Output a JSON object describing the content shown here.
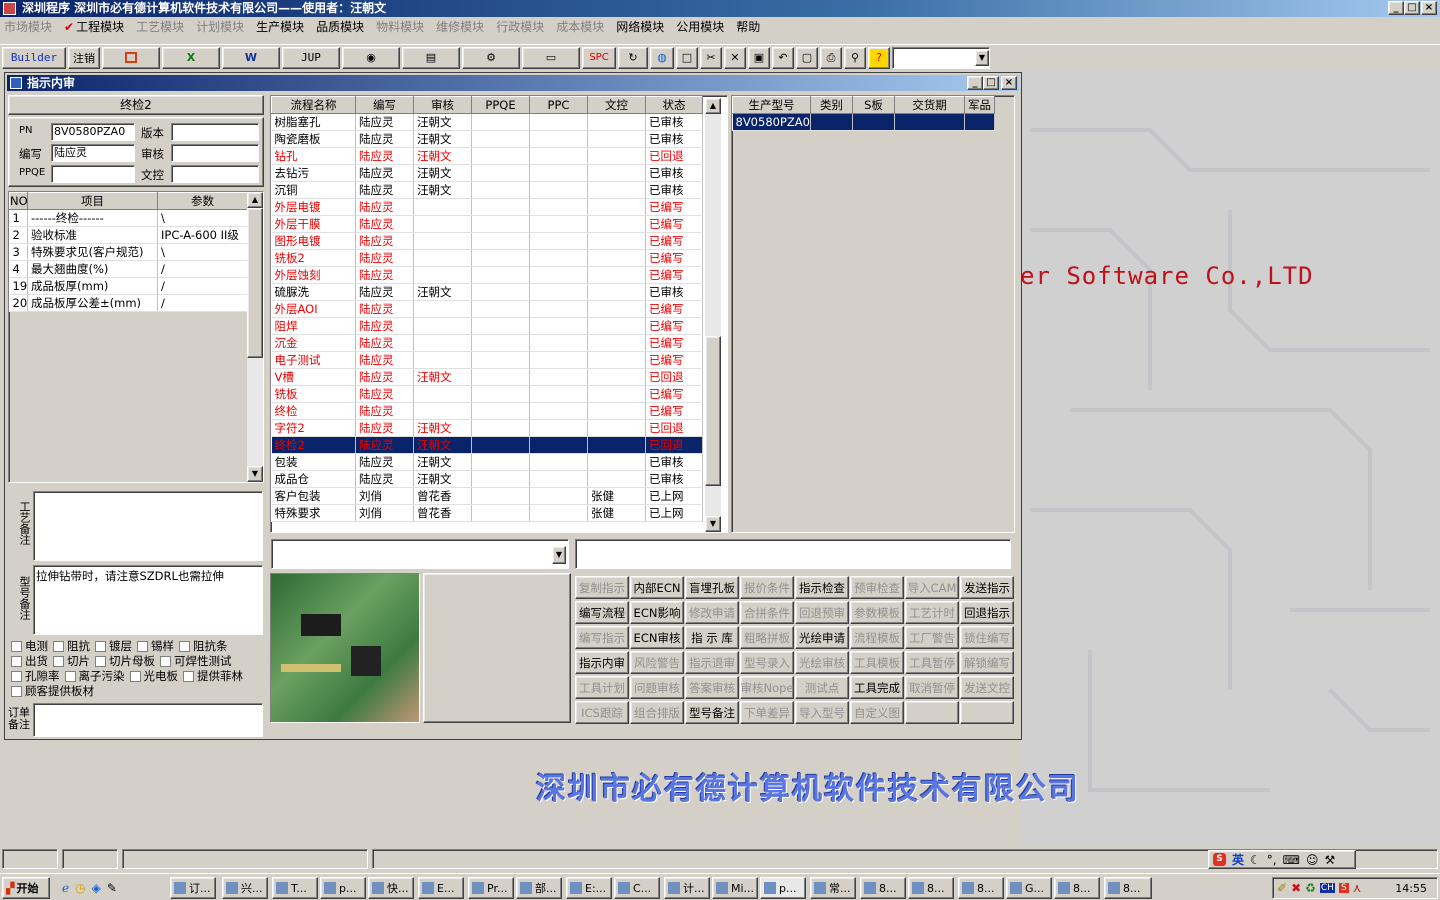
{
  "app": {
    "title": "深圳程序  深圳市必有德计算机软件技术有限公司——使用者：汪朝文"
  },
  "menu": [
    {
      "label": "市场模块",
      "enabled": false
    },
    {
      "label": "工程模块",
      "enabled": true
    },
    {
      "label": "工艺模块",
      "enabled": false
    },
    {
      "label": "计划模块",
      "enabled": false
    },
    {
      "label": "生产模块",
      "enabled": true
    },
    {
      "label": "品质模块",
      "enabled": true
    },
    {
      "label": "物料模块",
      "enabled": false
    },
    {
      "label": "维修模块",
      "enabled": false
    },
    {
      "label": "行政模块",
      "enabled": false
    },
    {
      "label": "成本模块",
      "enabled": false
    },
    {
      "label": "网络模块",
      "enabled": true
    },
    {
      "label": "公用模块",
      "enabled": true
    },
    {
      "label": "帮助",
      "enabled": true
    }
  ],
  "toolbar": {
    "builder": "Builder",
    "logout": "注销",
    "jup": "JUP",
    "spc": "SPC"
  },
  "watermark": {
    "en": "er Software Co.,LTD",
    "cn": "深圳市必有德计算机软件技术有限公司"
  },
  "child": {
    "title": "指示内审"
  },
  "left": {
    "section": "终检2",
    "pn_label": "PN",
    "pn": "8V0580PZA0",
    "version_label": "版本",
    "version": "",
    "author_label": "编写",
    "author": "陆应灵",
    "review_label": "审核",
    "review": "",
    "ppqe_label": "PPQE",
    "ppqe": "",
    "doc_label": "文控",
    "doc": ""
  },
  "params": {
    "headers": [
      "NO",
      "项目",
      "参数"
    ],
    "rows": [
      [
        "1",
        "------终检------",
        "\\"
      ],
      [
        "2",
        "验收标准",
        "IPC-A-600 II级"
      ],
      [
        "3",
        "特殊要求见(客户规范)",
        "\\"
      ],
      [
        "4",
        "最大翘曲度(%)",
        "/"
      ],
      [
        "19",
        "成品板厚(mm)",
        "/"
      ],
      [
        "20",
        "成品板厚公差±(mm)",
        "/"
      ]
    ]
  },
  "notes": {
    "process_label": "工艺备注",
    "process": "",
    "model_label": "型号备注",
    "model": "拉伸钻带时，请注意SZDRL也需拉伸",
    "order_label": "订单备注"
  },
  "checkboxes": [
    "电测",
    "阻抗",
    "镀层",
    "锡样",
    "阻抗条",
    "出货",
    "切片",
    "切片母板",
    "可焊性测试",
    "孔隙率",
    "离子污染",
    "光电板",
    "提供菲林",
    "顾客提供板材"
  ],
  "flow": {
    "headers": [
      "流程名称",
      "编写",
      "审核",
      "PPQE",
      "PPC",
      "文控",
      "状态"
    ],
    "rows": [
      {
        "c": [
          "树脂塞孔",
          "陆应灵",
          "汪朝文",
          "",
          "",
          "",
          "已审核"
        ],
        "s": "n"
      },
      {
        "c": [
          "陶瓷磨板",
          "陆应灵",
          "汪朝文",
          "",
          "",
          "",
          "已审核"
        ],
        "s": "n"
      },
      {
        "c": [
          "钻孔",
          "陆应灵",
          "汪朝文",
          "",
          "",
          "",
          "已回退"
        ],
        "s": "r"
      },
      {
        "c": [
          "去钻污",
          "陆应灵",
          "汪朝文",
          "",
          "",
          "",
          "已审核"
        ],
        "s": "n"
      },
      {
        "c": [
          "沉铜",
          "陆应灵",
          "汪朝文",
          "",
          "",
          "",
          "已审核"
        ],
        "s": "n"
      },
      {
        "c": [
          "外层电镀",
          "陆应灵",
          "",
          "",
          "",
          "",
          "已编写"
        ],
        "s": "r"
      },
      {
        "c": [
          "外层干膜",
          "陆应灵",
          "",
          "",
          "",
          "",
          "已编写"
        ],
        "s": "r"
      },
      {
        "c": [
          "图形电镀",
          "陆应灵",
          "",
          "",
          "",
          "",
          "已编写"
        ],
        "s": "r"
      },
      {
        "c": [
          "铣板2",
          "陆应灵",
          "",
          "",
          "",
          "",
          "已编写"
        ],
        "s": "r"
      },
      {
        "c": [
          "外层蚀刻",
          "陆应灵",
          "",
          "",
          "",
          "",
          "已编写"
        ],
        "s": "r"
      },
      {
        "c": [
          "硫脲洗",
          "陆应灵",
          "汪朝文",
          "",
          "",
          "",
          "已审核"
        ],
        "s": "n"
      },
      {
        "c": [
          "外层AOI",
          "陆应灵",
          "",
          "",
          "",
          "",
          "已编写"
        ],
        "s": "r"
      },
      {
        "c": [
          "阻焊",
          "陆应灵",
          "",
          "",
          "",
          "",
          "已编写"
        ],
        "s": "r"
      },
      {
        "c": [
          "沉金",
          "陆应灵",
          "",
          "",
          "",
          "",
          "已编写"
        ],
        "s": "r"
      },
      {
        "c": [
          "电子测试",
          "陆应灵",
          "",
          "",
          "",
          "",
          "已编写"
        ],
        "s": "r"
      },
      {
        "c": [
          "V槽",
          "陆应灵",
          "汪朝文",
          "",
          "",
          "",
          "已回退"
        ],
        "s": "r"
      },
      {
        "c": [
          "铣板",
          "陆应灵",
          "",
          "",
          "",
          "",
          "已编写"
        ],
        "s": "r"
      },
      {
        "c": [
          "终检",
          "陆应灵",
          "",
          "",
          "",
          "",
          "已编写"
        ],
        "s": "r"
      },
      {
        "c": [
          "字符2",
          "陆应灵",
          "汪朝文",
          "",
          "",
          "",
          "已回退"
        ],
        "s": "r"
      },
      {
        "c": [
          "终检2",
          "陆应灵",
          "汪朝文",
          "",
          "",
          "",
          "已回退"
        ],
        "s": "sel"
      },
      {
        "c": [
          "包装",
          "陆应灵",
          "汪朝文",
          "",
          "",
          "",
          "已审核"
        ],
        "s": "n"
      },
      {
        "c": [
          "成品仓",
          "陆应灵",
          "汪朝文",
          "",
          "",
          "",
          "已审核"
        ],
        "s": "n"
      },
      {
        "c": [
          "客户包装",
          "刘俏",
          "曾花香",
          "",
          "",
          "张健",
          "已上网"
        ],
        "s": "n"
      },
      {
        "c": [
          "特殊要求",
          "刘俏",
          "曾花香",
          "",
          "",
          "张健",
          "已上网"
        ],
        "s": "n"
      }
    ]
  },
  "models": {
    "headers": [
      "生产型号",
      "类别",
      "S板",
      "交货期",
      "军品"
    ],
    "rows": [
      [
        "8V0580PZA0",
        "",
        "",
        "",
        ""
      ]
    ]
  },
  "buttons": [
    [
      {
        "t": "复制指示",
        "e": false
      },
      {
        "t": "内部ECN",
        "e": true
      },
      {
        "t": "盲埋孔板",
        "e": true
      },
      {
        "t": "报价条件",
        "e": false
      },
      {
        "t": "指示检查",
        "e": true
      },
      {
        "t": "预审检查",
        "e": false
      },
      {
        "t": "导入CAM",
        "e": false
      },
      {
        "t": "发送指示",
        "e": true
      }
    ],
    [
      {
        "t": "编写流程",
        "e": true
      },
      {
        "t": "ECN影响",
        "e": true
      },
      {
        "t": "修改申请",
        "e": false
      },
      {
        "t": "合拼条件",
        "e": false
      },
      {
        "t": "回退预审",
        "e": false
      },
      {
        "t": "参数模板",
        "e": false
      },
      {
        "t": "工艺计时",
        "e": false
      },
      {
        "t": "回退指示",
        "e": true
      }
    ],
    [
      {
        "t": "编写指示",
        "e": false
      },
      {
        "t": "ECN审核",
        "e": true
      },
      {
        "t": "指 示 库",
        "e": true
      },
      {
        "t": "粗略拼板",
        "e": false
      },
      {
        "t": "光绘申请",
        "e": true
      },
      {
        "t": "流程模板",
        "e": false
      },
      {
        "t": "工厂警告",
        "e": false
      },
      {
        "t": "锁住编写",
        "e": false
      }
    ],
    [
      {
        "t": "指示内审",
        "e": true
      },
      {
        "t": "风险警告",
        "e": false
      },
      {
        "t": "指示退审",
        "e": false
      },
      {
        "t": "型号录入",
        "e": false
      },
      {
        "t": "光绘审核",
        "e": false
      },
      {
        "t": "工具模板",
        "e": false
      },
      {
        "t": "工具暂停",
        "e": false
      },
      {
        "t": "解锁编写",
        "e": false
      }
    ],
    [
      {
        "t": "工具计划",
        "e": false
      },
      {
        "t": "问题审核",
        "e": false
      },
      {
        "t": "答案审核",
        "e": false
      },
      {
        "t": "审核Nope",
        "e": false
      },
      {
        "t": "测试点",
        "e": false
      },
      {
        "t": "工具完成",
        "e": true
      },
      {
        "t": "取消暂停",
        "e": false
      },
      {
        "t": "发送文控",
        "e": false
      }
    ],
    [
      {
        "t": "ICS跟踪",
        "e": false
      },
      {
        "t": "组合排版",
        "e": false
      },
      {
        "t": "型号备注",
        "e": true
      },
      {
        "t": "下单差异",
        "e": false
      },
      {
        "t": "导入型号",
        "e": false
      },
      {
        "t": "自定义图",
        "e": false
      },
      {
        "t": "",
        "e": false
      },
      {
        "t": "",
        "e": false
      }
    ]
  ],
  "ime": {
    "lang": "英"
  },
  "taskbar": {
    "start": "开始",
    "tasks": [
      "订...",
      "兴...",
      "T...",
      "p...",
      "快...",
      "E...",
      "Pr...",
      "部...",
      "E:...",
      "C...",
      "计...",
      "Mi...",
      "p...",
      "常...",
      "8...",
      "8...",
      "8...",
      "G...",
      "8...",
      "8..."
    ],
    "clock": "14:55",
    "tray_lang": "CH"
  },
  "colors": {
    "title_start": "#0a246a",
    "title_end": "#a6caf0",
    "red_row": "#ee0000",
    "selection": "#0a246a"
  }
}
